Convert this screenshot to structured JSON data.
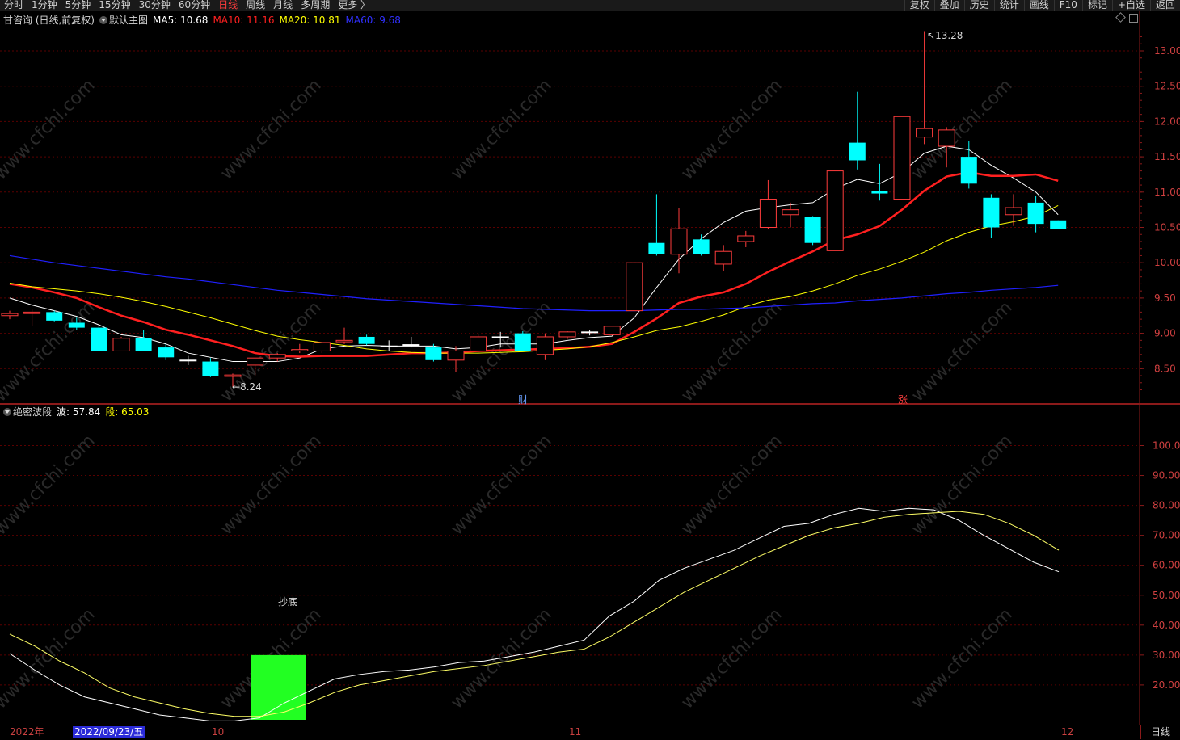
{
  "toolbar": {
    "periods": [
      "分时",
      "1分钟",
      "5分钟",
      "15分钟",
      "30分钟",
      "60分钟",
      "日线",
      "周线",
      "月线",
      "多周期",
      "更多 〉"
    ],
    "active_period": "日线",
    "actions": [
      "复权",
      "叠加",
      "历史",
      "统计",
      "画线",
      "F10",
      "标记",
      "+自选",
      "返回"
    ]
  },
  "main_legend": {
    "stock": "甘咨询 (日线,前复权)",
    "template": "默认主图",
    "ma5": "MA5: 10.68",
    "ma10": "MA10: 11.16",
    "ma20": "MA20: 10.81",
    "ma60": "MA60: 9.68"
  },
  "ind_legend": {
    "name": "绝密波段",
    "wave": "波: 57.84",
    "segment": "段: 65.03"
  },
  "annotations": {
    "high": "13.28",
    "low": "8.24",
    "signal": "抄底",
    "tag_cai": "财",
    "tag_zhang": "涨"
  },
  "watermark": "www.cfchi.com",
  "bottom": {
    "year": "2022年",
    "cursor_date": "2022/09/23/五",
    "months": [
      "10",
      "11",
      "12"
    ],
    "period_button": "日线"
  },
  "colors": {
    "up": "#ff3c3c",
    "down": "#00ffff",
    "ma5": "#ffffff",
    "ma10": "#ff2020",
    "ma20": "#ffff00",
    "ma60": "#2020ff",
    "grid": "#5a0000",
    "axis_text": "#d04040"
  },
  "price_axis": [
    "13.00",
    "12.50",
    "12.00",
    "11.50",
    "11.00",
    "10.50",
    "10.00",
    "9.50",
    "9.00",
    "8.50"
  ],
  "ind_axis": [
    "100.00",
    "90.00",
    "80.00",
    "70.00",
    "60.00",
    "50.00",
    "40.00",
    "30.00",
    "20.00"
  ],
  "chart_data": {
    "type": "candlestick",
    "candles": [
      {
        "o": 9.25,
        "h": 9.32,
        "l": 9.2,
        "c": 9.28
      },
      {
        "o": 9.28,
        "h": 9.35,
        "l": 9.1,
        "c": 9.3
      },
      {
        "o": 9.3,
        "h": 9.32,
        "l": 9.17,
        "c": 9.18
      },
      {
        "o": 9.15,
        "h": 9.22,
        "l": 9.05,
        "c": 9.08
      },
      {
        "o": 9.08,
        "h": 9.1,
        "l": 8.75,
        "c": 8.75
      },
      {
        "o": 8.75,
        "h": 8.95,
        "l": 8.75,
        "c": 8.93
      },
      {
        "o": 8.93,
        "h": 9.05,
        "l": 8.75,
        "c": 8.75
      },
      {
        "o": 8.8,
        "h": 8.85,
        "l": 8.62,
        "c": 8.66
      },
      {
        "o": 8.62,
        "h": 8.68,
        "l": 8.55,
        "c": 8.62
      },
      {
        "o": 8.6,
        "h": 8.65,
        "l": 8.38,
        "c": 8.4
      },
      {
        "o": 8.39,
        "h": 8.43,
        "l": 8.24,
        "c": 8.41
      },
      {
        "o": 8.55,
        "h": 8.65,
        "l": 8.4,
        "c": 8.65
      },
      {
        "o": 8.65,
        "h": 8.72,
        "l": 8.6,
        "c": 8.7
      },
      {
        "o": 8.75,
        "h": 8.85,
        "l": 8.72,
        "c": 8.77
      },
      {
        "o": 8.75,
        "h": 8.88,
        "l": 8.72,
        "c": 8.87
      },
      {
        "o": 8.88,
        "h": 9.08,
        "l": 8.85,
        "c": 8.9
      },
      {
        "o": 8.95,
        "h": 8.98,
        "l": 8.83,
        "c": 8.85
      },
      {
        "o": 8.82,
        "h": 8.9,
        "l": 8.75,
        "c": 8.82
      },
      {
        "o": 8.84,
        "h": 8.95,
        "l": 8.8,
        "c": 8.84
      },
      {
        "o": 8.8,
        "h": 8.85,
        "l": 8.6,
        "c": 8.62
      },
      {
        "o": 8.62,
        "h": 8.82,
        "l": 8.45,
        "c": 8.75
      },
      {
        "o": 8.75,
        "h": 9.0,
        "l": 8.72,
        "c": 8.95
      },
      {
        "o": 8.95,
        "h": 9.02,
        "l": 8.8,
        "c": 8.95
      },
      {
        "o": 9.0,
        "h": 9.03,
        "l": 8.75,
        "c": 8.75
      },
      {
        "o": 8.7,
        "h": 9.0,
        "l": 8.62,
        "c": 8.95
      },
      {
        "o": 8.95,
        "h": 9.03,
        "l": 8.92,
        "c": 9.02
      },
      {
        "o": 9.02,
        "h": 9.05,
        "l": 8.97,
        "c": 9.02
      },
      {
        "o": 8.98,
        "h": 9.1,
        "l": 8.97,
        "c": 9.1
      },
      {
        "o": 9.32,
        "h": 10.0,
        "l": 9.32,
        "c": 10.0
      },
      {
        "o": 10.28,
        "h": 10.97,
        "l": 10.1,
        "c": 10.12
      },
      {
        "o": 10.12,
        "h": 10.77,
        "l": 9.85,
        "c": 10.48
      },
      {
        "o": 10.33,
        "h": 10.4,
        "l": 10.1,
        "c": 10.12
      },
      {
        "o": 9.98,
        "h": 10.25,
        "l": 9.88,
        "c": 10.16
      },
      {
        "o": 10.3,
        "h": 10.45,
        "l": 10.22,
        "c": 10.38
      },
      {
        "o": 10.5,
        "h": 11.17,
        "l": 10.48,
        "c": 10.9
      },
      {
        "o": 10.68,
        "h": 10.85,
        "l": 10.5,
        "c": 10.75
      },
      {
        "o": 10.65,
        "h": 10.66,
        "l": 10.25,
        "c": 10.28
      },
      {
        "o": 10.17,
        "h": 11.3,
        "l": 10.17,
        "c": 11.3
      },
      {
        "o": 11.7,
        "h": 12.42,
        "l": 11.32,
        "c": 11.45
      },
      {
        "o": 11.02,
        "h": 11.4,
        "l": 10.88,
        "c": 10.98
      },
      {
        "o": 10.9,
        "h": 12.07,
        "l": 10.9,
        "c": 12.07
      },
      {
        "o": 11.78,
        "h": 13.28,
        "l": 11.68,
        "c": 11.9
      },
      {
        "o": 11.65,
        "h": 11.92,
        "l": 11.35,
        "c": 11.88
      },
      {
        "o": 11.5,
        "h": 11.72,
        "l": 11.05,
        "c": 11.12
      },
      {
        "o": 10.92,
        "h": 10.97,
        "l": 10.35,
        "c": 10.5
      },
      {
        "o": 10.68,
        "h": 10.97,
        "l": 10.52,
        "c": 10.78
      },
      {
        "o": 10.85,
        "h": 10.95,
        "l": 10.43,
        "c": 10.55
      },
      {
        "o": 10.6,
        "h": 10.6,
        "l": 10.48,
        "c": 10.48
      }
    ],
    "series": [
      {
        "name": "MA5",
        "values": [
          9.5,
          9.4,
          9.32,
          9.24,
          9.12,
          8.98,
          8.94,
          8.85,
          8.72,
          8.66,
          8.6,
          8.6,
          8.6,
          8.65,
          8.78,
          8.82,
          8.83,
          8.82,
          8.82,
          8.82,
          8.78,
          8.8,
          8.85,
          8.85,
          8.85,
          8.9,
          8.94,
          8.96,
          9.22,
          9.65,
          10.05,
          10.34,
          10.57,
          10.73,
          10.78,
          10.82,
          10.85,
          11.05,
          11.18,
          11.12,
          11.28,
          11.55,
          11.65,
          11.6,
          11.38,
          11.2,
          11.0,
          10.68
        ]
      },
      {
        "name": "MA10",
        "values": [
          9.7,
          9.65,
          9.58,
          9.5,
          9.37,
          9.25,
          9.16,
          9.05,
          8.98,
          8.9,
          8.82,
          8.72,
          8.68,
          8.67,
          8.68,
          8.68,
          8.68,
          8.7,
          8.72,
          8.72,
          8.73,
          8.75,
          8.76,
          8.77,
          8.78,
          8.79,
          8.81,
          8.85,
          9.02,
          9.21,
          9.43,
          9.52,
          9.58,
          9.7,
          9.87,
          10.02,
          10.16,
          10.32,
          10.4,
          10.52,
          10.75,
          11.02,
          11.22,
          11.28,
          11.23,
          11.23,
          11.25,
          11.16
        ]
      },
      {
        "name": "MA20",
        "values": [
          9.71,
          9.66,
          9.63,
          9.6,
          9.56,
          9.51,
          9.45,
          9.38,
          9.3,
          9.22,
          9.13,
          9.04,
          8.96,
          8.91,
          8.87,
          8.83,
          8.78,
          8.75,
          8.73,
          8.72,
          8.72,
          8.72,
          8.73,
          8.74,
          8.76,
          8.78,
          8.81,
          8.87,
          8.95,
          9.04,
          9.09,
          9.17,
          9.26,
          9.38,
          9.47,
          9.52,
          9.6,
          9.7,
          9.82,
          9.91,
          10.02,
          10.15,
          10.31,
          10.43,
          10.52,
          10.58,
          10.66,
          10.81
        ]
      },
      {
        "name": "MA60",
        "values": [
          10.1,
          10.05,
          10.0,
          9.96,
          9.92,
          9.88,
          9.84,
          9.8,
          9.77,
          9.73,
          9.69,
          9.65,
          9.61,
          9.58,
          9.55,
          9.52,
          9.49,
          9.47,
          9.45,
          9.43,
          9.41,
          9.39,
          9.37,
          9.35,
          9.34,
          9.33,
          9.32,
          9.32,
          9.32,
          9.33,
          9.34,
          9.34,
          9.35,
          9.36,
          9.38,
          9.4,
          9.42,
          9.43,
          9.46,
          9.48,
          9.5,
          9.53,
          9.56,
          9.58,
          9.61,
          9.63,
          9.65,
          9.68
        ]
      }
    ],
    "indicator": {
      "name": "绝密波段",
      "ylim": [
        0,
        100
      ],
      "series": [
        {
          "name": "波",
          "values": [
            30.5,
            25,
            20,
            16,
            14,
            12,
            10,
            9,
            8,
            8,
            9,
            14,
            18,
            22,
            23.5,
            24.5,
            25,
            26,
            27.5,
            28,
            29.5,
            31,
            33,
            35,
            43,
            48,
            55,
            59,
            62,
            65,
            69,
            73,
            74,
            77,
            79,
            78,
            79,
            78.5,
            75,
            70,
            65.5,
            61,
            57.84
          ]
        },
        {
          "name": "段",
          "values": [
            37,
            33,
            28,
            24,
            19,
            16,
            14,
            12,
            10.5,
            9.5,
            9.5,
            11,
            14,
            17.5,
            20,
            21.5,
            23,
            24.5,
            25.5,
            26.5,
            28,
            29.5,
            31,
            32,
            36,
            41,
            46,
            51,
            55,
            59,
            63,
            66.5,
            70,
            72.5,
            74,
            76,
            77,
            77.5,
            78,
            77,
            74,
            70,
            65.03
          ]
        }
      ],
      "signal_bar": {
        "label": "抄底",
        "top": 30,
        "bottom": 0
      }
    }
  }
}
